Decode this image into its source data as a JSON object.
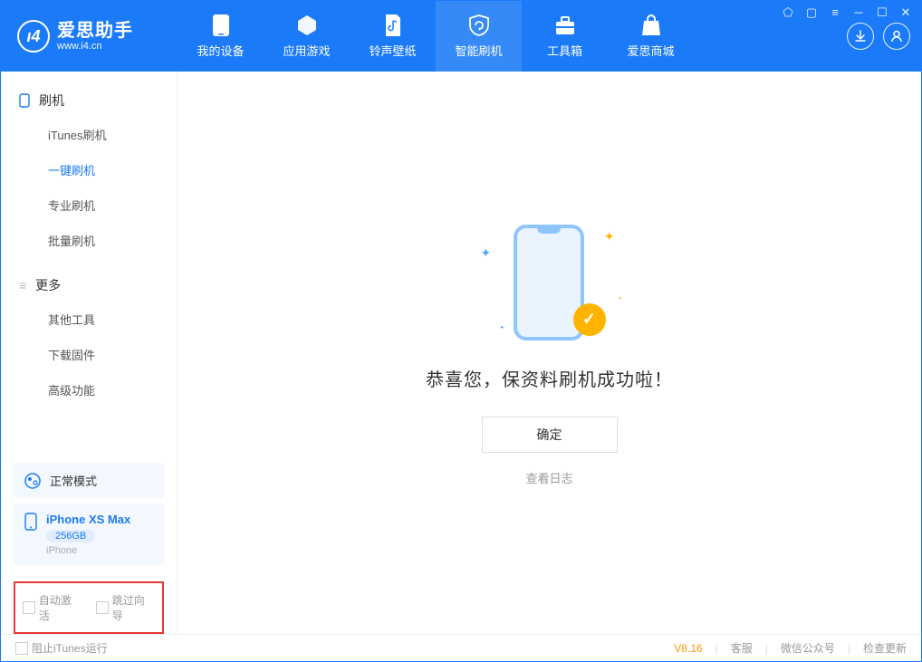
{
  "app": {
    "title": "爱思助手",
    "subtitle": "www.i4.cn"
  },
  "nav": {
    "items": [
      {
        "label": "我的设备"
      },
      {
        "label": "应用游戏"
      },
      {
        "label": "铃声壁纸"
      },
      {
        "label": "智能刷机"
      },
      {
        "label": "工具箱"
      },
      {
        "label": "爱思商城"
      }
    ]
  },
  "sidebar": {
    "section1": "刷机",
    "items1": [
      {
        "label": "iTunes刷机"
      },
      {
        "label": "一键刷机"
      },
      {
        "label": "专业刷机"
      },
      {
        "label": "批量刷机"
      }
    ],
    "section2": "更多",
    "items2": [
      {
        "label": "其他工具"
      },
      {
        "label": "下载固件"
      },
      {
        "label": "高级功能"
      }
    ]
  },
  "device": {
    "mode": "正常模式",
    "name": "iPhone XS Max",
    "capacity": "256GB",
    "type": "iPhone"
  },
  "options": {
    "auto_activate": "自动激活",
    "skip_guide": "跳过向导"
  },
  "main": {
    "success_title": "恭喜您，保资料刷机成功啦！",
    "ok_btn": "确定",
    "view_log": "查看日志"
  },
  "footer": {
    "block_itunes": "阻止iTunes运行",
    "version": "V8.16",
    "support": "客服",
    "wechat": "微信公众号",
    "check_update": "检查更新"
  }
}
